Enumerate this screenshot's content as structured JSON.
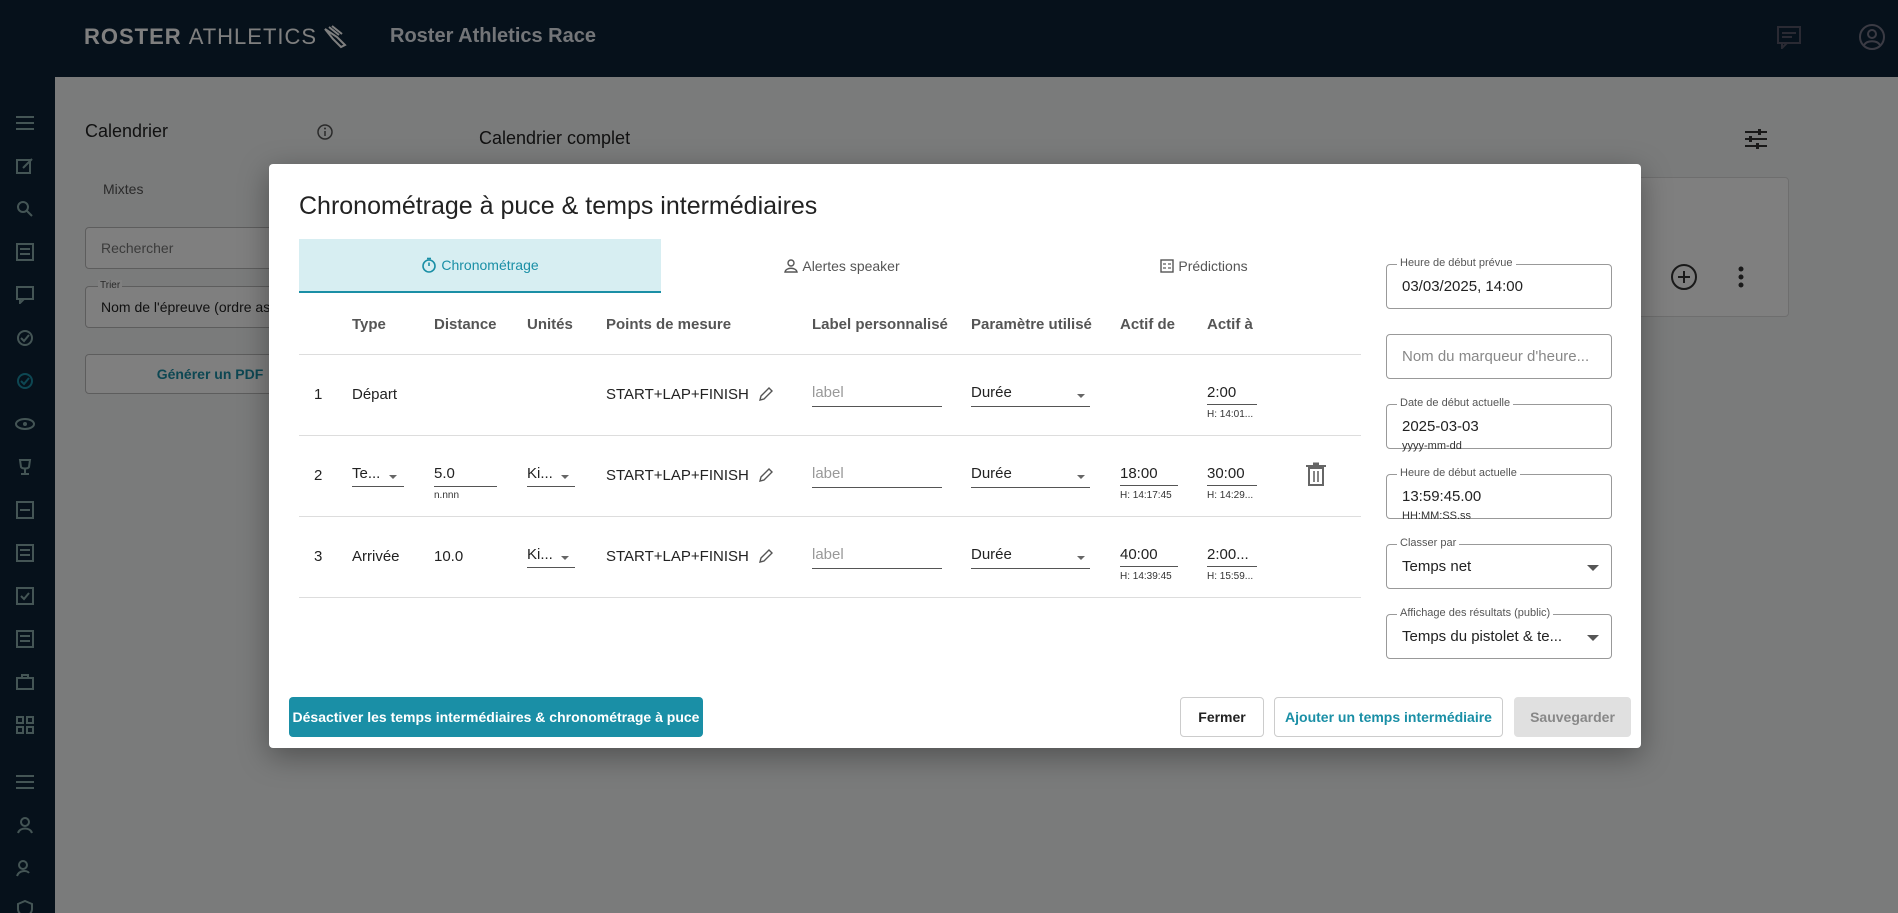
{
  "topbar": {
    "logo_bold": "ROSTER",
    "logo_thin": "ATHLETICS",
    "app_title": "Roster Athletics Race"
  },
  "background": {
    "left_title": "Calendrier",
    "mixtes": "Mixtes",
    "search_placeholder": "Rechercher",
    "sort_label": "Trier",
    "sort_value": "Nom de l'épreuve (ordre asc",
    "pdf_button": "Générer un PDF",
    "main_title": "Calendrier complet"
  },
  "modal": {
    "title": "Chronométrage à puce & temps intermédiaires",
    "tabs": [
      {
        "label": "Chronométrage",
        "icon": "stopwatch-icon"
      },
      {
        "label": "Alertes speaker",
        "icon": "person-icon"
      },
      {
        "label": "Prédictions",
        "icon": "calculator-icon"
      }
    ],
    "columns": {
      "type": "Type",
      "distance": "Distance",
      "units": "Unités",
      "points": "Points de mesure",
      "label": "Label personnalisé",
      "param": "Paramètre utilisé",
      "active_from": "Actif de",
      "active_to": "Actif à"
    },
    "rows": [
      {
        "num": "1",
        "type": "Départ",
        "distance": "",
        "distance_hint": "",
        "units": "",
        "points": "START+LAP+FINISH",
        "label_placeholder": "label",
        "param": "Durée",
        "active_from": "",
        "active_from_sub": "",
        "active_to": "2:00",
        "active_to_sub": "H: 14:01..."
      },
      {
        "num": "2",
        "type": "Te...",
        "distance": "5.0",
        "distance_hint": "n.nnn",
        "units": "Ki...",
        "points": "START+LAP+FINISH",
        "label_placeholder": "label",
        "param": "Durée",
        "active_from": "18:00",
        "active_from_sub": "H: 14:17:45",
        "active_to": "30:00",
        "active_to_sub": "H: 14:29..."
      },
      {
        "num": "3",
        "type": "Arrivée",
        "distance": "10.0",
        "distance_hint": "",
        "units": "Ki...",
        "points": "START+LAP+FINISH",
        "label_placeholder": "label",
        "param": "Durée",
        "active_from": "40:00",
        "active_from_sub": "H: 14:39:45",
        "active_to": "2:00...",
        "active_to_sub": "H: 15:59..."
      }
    ],
    "right": {
      "planned_start_label": "Heure de début prévue",
      "planned_start_value": "03/03/2025, 14:00",
      "marker_placeholder": "Nom du marqueur d'heure...",
      "actual_date_label": "Date de début actuelle",
      "actual_date_value": "2025-03-03",
      "actual_date_hint": "yyyy-mm-dd",
      "actual_time_label": "Heure de début actuelle",
      "actual_time_value": "13:59:45.00",
      "actual_time_hint": "HH:MM:SS.ss",
      "rank_label": "Classer par",
      "rank_value": "Temps net",
      "display_label": "Affichage des résultats (public)",
      "display_value": "Temps du pistolet & te..."
    },
    "buttons": {
      "disable": "Désactiver les temps intermédiaires & chronométrage à puce",
      "close": "Fermer",
      "add_split": "Ajouter un temps intermédiaire",
      "save": "Sauvegarder"
    }
  },
  "colors": {
    "accent": "#1a8fa6",
    "topbar": "#0d2236",
    "tab_active_bg": "#d7eef2"
  }
}
